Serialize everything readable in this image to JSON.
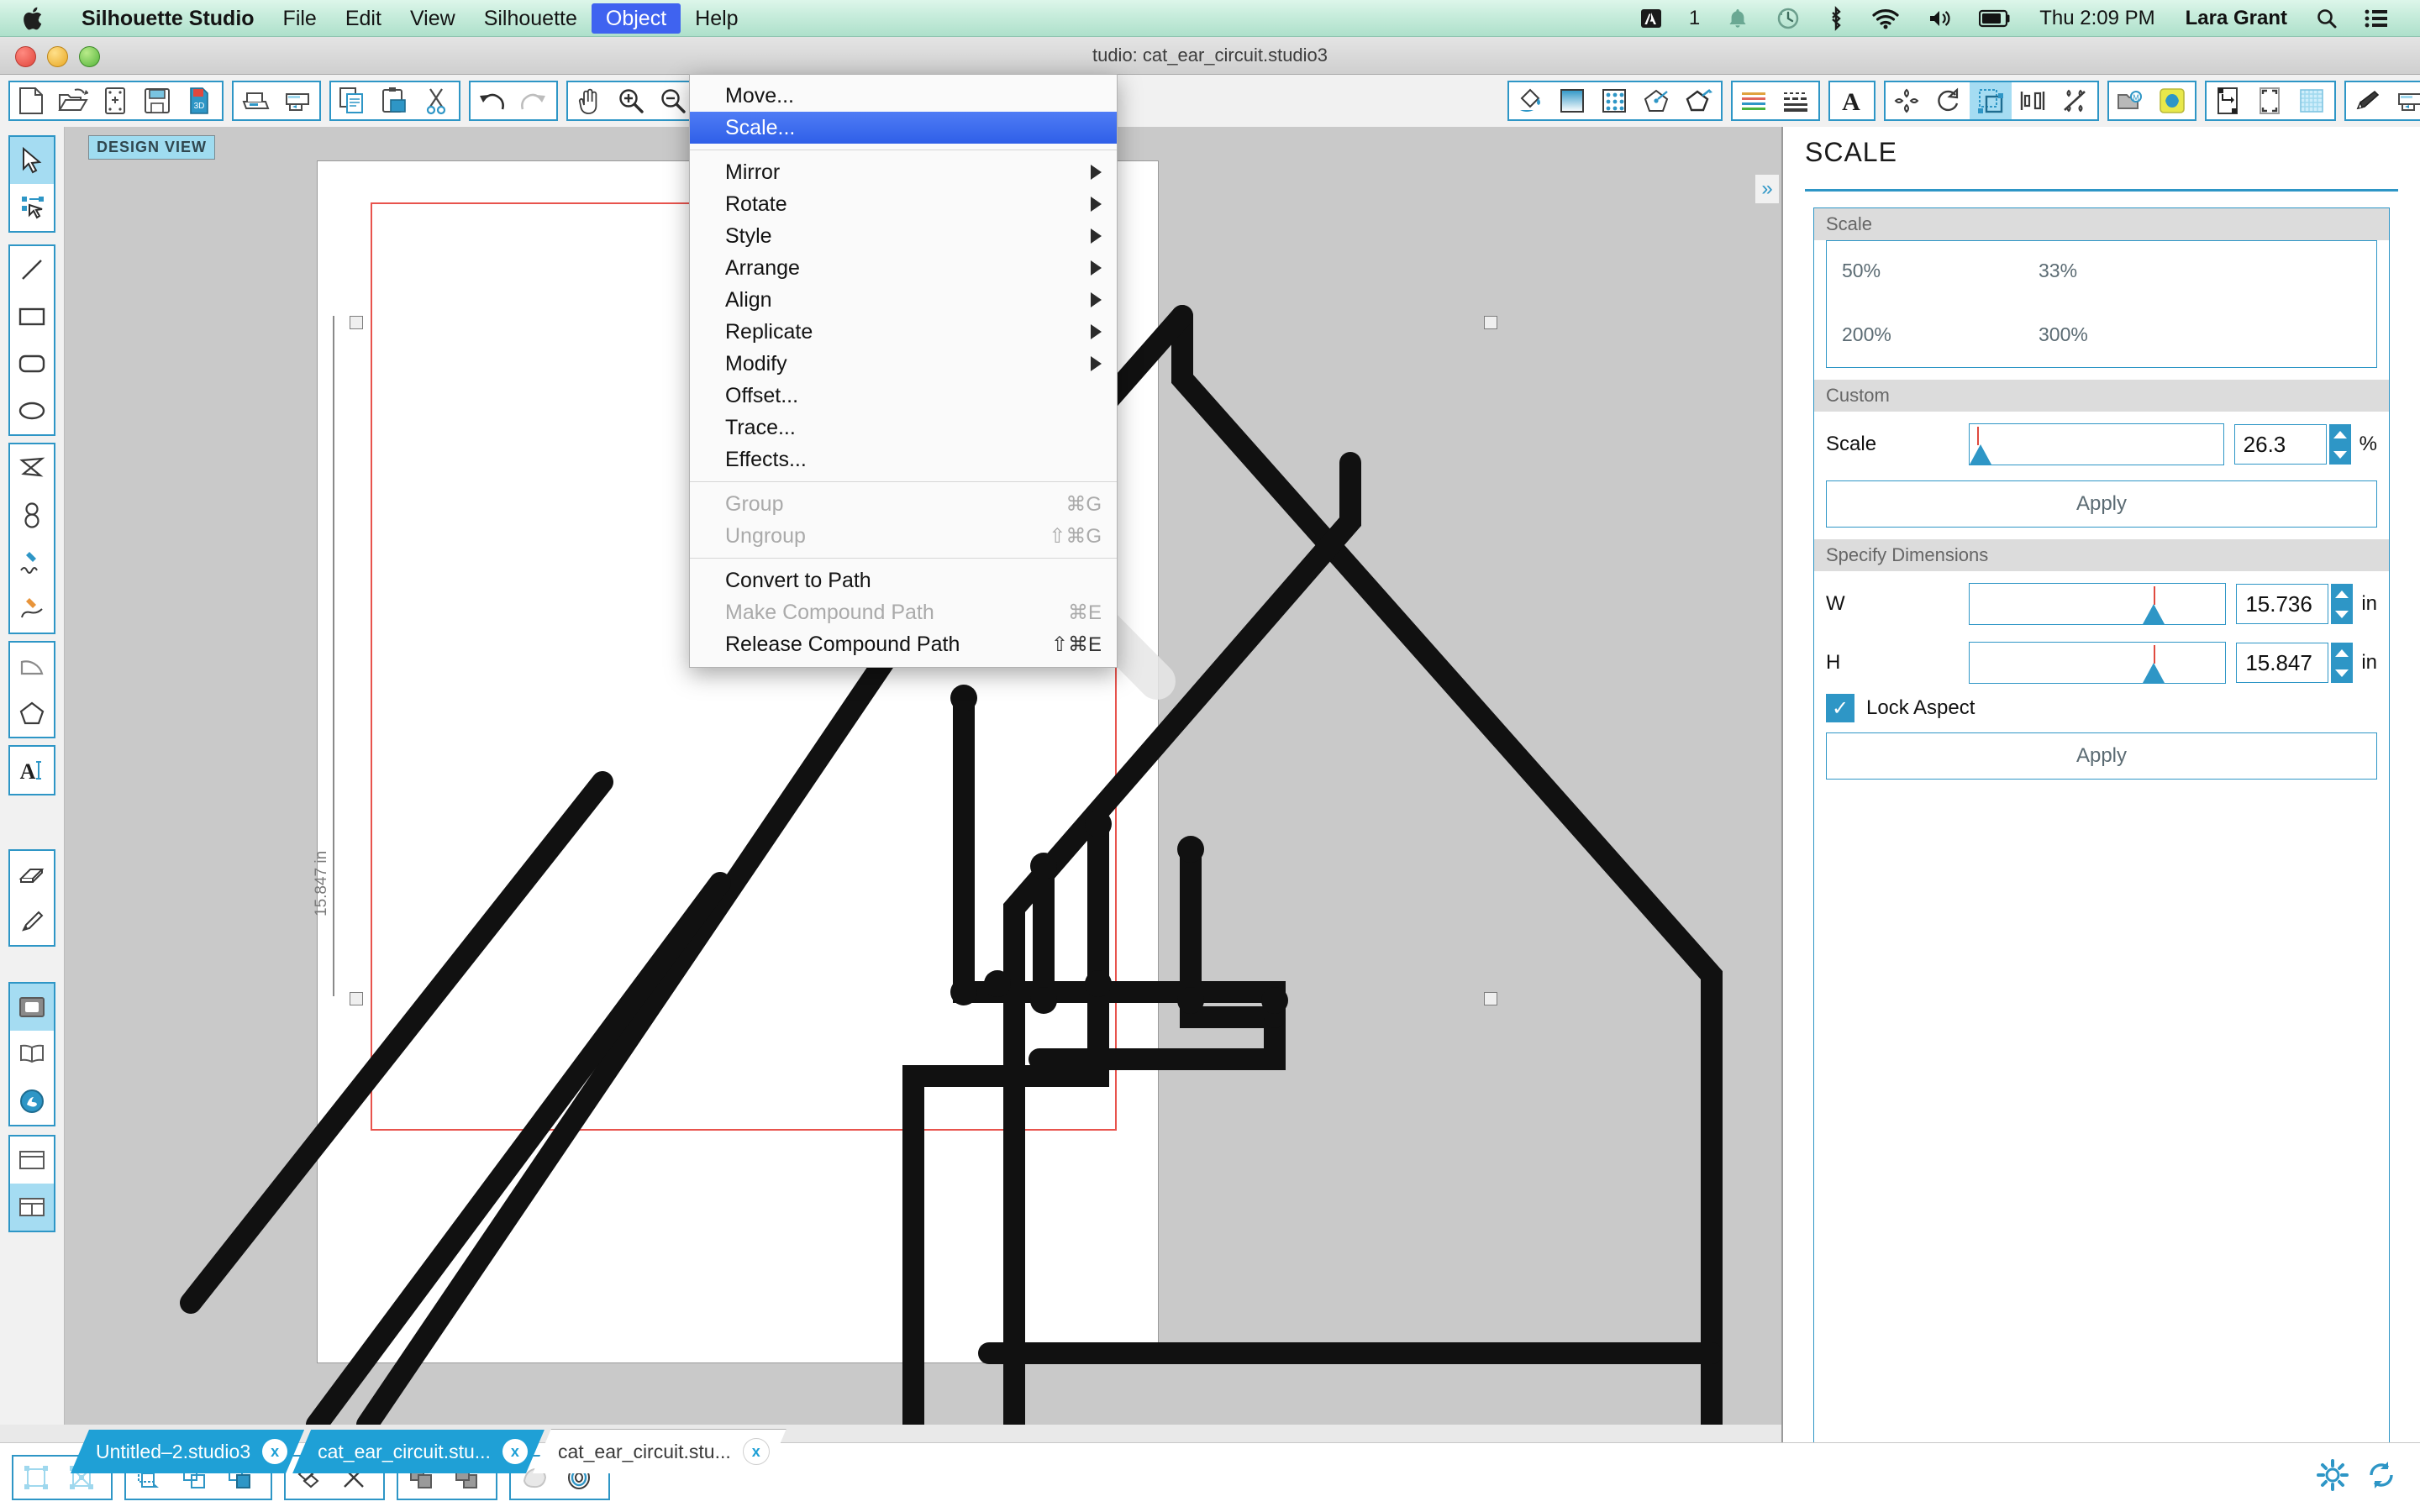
{
  "menubar": {
    "apple_icon": "apple-logo-icon",
    "app_name": "Silhouette Studio",
    "items": [
      {
        "label": "File",
        "active": false
      },
      {
        "label": "Edit",
        "active": false
      },
      {
        "label": "View",
        "active": false
      },
      {
        "label": "Silhouette",
        "active": false
      },
      {
        "label": "Object",
        "active": true
      },
      {
        "label": "Help",
        "active": false
      }
    ],
    "status_items": [
      {
        "name": "adobe-creative-cloud-icon",
        "label": ""
      },
      {
        "name": "notification-count",
        "label": "1"
      },
      {
        "name": "bell-icon",
        "label": ""
      },
      {
        "name": "time-machine-icon",
        "label": ""
      },
      {
        "name": "bluetooth-icon",
        "label": ""
      },
      {
        "name": "wifi-icon",
        "label": ""
      },
      {
        "name": "volume-icon",
        "label": ""
      },
      {
        "name": "battery-icon",
        "label": ""
      }
    ],
    "clock": "Thu 2:09 PM",
    "user_name": "Lara Grant",
    "search_icon": "spotlight-search-icon",
    "notification_center_icon": "notification-center-icon"
  },
  "window": {
    "title": "tudio: cat_ear_circuit.studio3"
  },
  "object_menu": {
    "groups": [
      {
        "items": [
          {
            "label": "Move...",
            "shortcut": "",
            "submenu": false,
            "disabled": false,
            "highlighted": false
          },
          {
            "label": "Scale...",
            "shortcut": "",
            "submenu": false,
            "disabled": false,
            "highlighted": true
          }
        ]
      },
      {
        "items": [
          {
            "label": "Mirror",
            "shortcut": "",
            "submenu": true,
            "disabled": false,
            "highlighted": false
          },
          {
            "label": "Rotate",
            "shortcut": "",
            "submenu": true,
            "disabled": false,
            "highlighted": false
          },
          {
            "label": "Style",
            "shortcut": "",
            "submenu": true,
            "disabled": false,
            "highlighted": false
          },
          {
            "label": "Arrange",
            "shortcut": "",
            "submenu": true,
            "disabled": false,
            "highlighted": false
          },
          {
            "label": "Align",
            "shortcut": "",
            "submenu": true,
            "disabled": false,
            "highlighted": false
          },
          {
            "label": "Replicate",
            "shortcut": "",
            "submenu": true,
            "disabled": false,
            "highlighted": false
          },
          {
            "label": "Modify",
            "shortcut": "",
            "submenu": true,
            "disabled": false,
            "highlighted": false
          },
          {
            "label": "Offset...",
            "shortcut": "",
            "submenu": false,
            "disabled": false,
            "highlighted": false
          },
          {
            "label": "Trace...",
            "shortcut": "",
            "submenu": false,
            "disabled": false,
            "highlighted": false
          },
          {
            "label": "Effects...",
            "shortcut": "",
            "submenu": false,
            "disabled": false,
            "highlighted": false
          }
        ]
      },
      {
        "items": [
          {
            "label": "Group",
            "shortcut": "⌘G",
            "submenu": false,
            "disabled": true,
            "highlighted": false
          },
          {
            "label": "Ungroup",
            "shortcut": "⇧⌘G",
            "submenu": false,
            "disabled": true,
            "highlighted": false
          }
        ]
      },
      {
        "items": [
          {
            "label": "Convert to Path",
            "shortcut": "",
            "submenu": false,
            "disabled": false,
            "highlighted": false
          },
          {
            "label": "Make Compound Path",
            "shortcut": "⌘E",
            "submenu": false,
            "disabled": true,
            "highlighted": false
          },
          {
            "label": "Release Compound Path",
            "shortcut": "⇧⌘E",
            "submenu": false,
            "disabled": false,
            "highlighted": false
          }
        ]
      }
    ]
  },
  "toolbar": {
    "groups": [
      {
        "buttons": [
          {
            "name": "new-document-icon"
          },
          {
            "name": "open-document-icon"
          },
          {
            "name": "new-page-icon"
          },
          {
            "name": "save-icon"
          },
          {
            "name": "save-as-sd-icon"
          }
        ]
      },
      {
        "buttons": [
          {
            "name": "print-icon"
          },
          {
            "name": "send-to-silhouette-icon"
          }
        ]
      },
      {
        "buttons": [
          {
            "name": "copy-icon"
          },
          {
            "name": "paste-icon"
          },
          {
            "name": "cut-icon"
          }
        ]
      },
      {
        "buttons": [
          {
            "name": "undo-icon"
          },
          {
            "name": "redo-icon"
          }
        ]
      },
      {
        "buttons": [
          {
            "name": "pan-hand-icon"
          },
          {
            "name": "zoom-in-icon"
          },
          {
            "name": "zoom-out-icon"
          }
        ]
      },
      {
        "buttons": [
          {
            "name": "fill-color-icon"
          },
          {
            "name": "fill-gradient-icon"
          },
          {
            "name": "fill-pattern-icon"
          },
          {
            "name": "line-color-icon"
          },
          {
            "name": "line-style-icon"
          }
        ]
      },
      {
        "buttons": [
          {
            "name": "line-weight-icon"
          },
          {
            "name": "dashed-line-icon"
          }
        ]
      },
      {
        "buttons": [
          {
            "name": "text-style-icon"
          }
        ]
      },
      {
        "buttons": [
          {
            "name": "move-object-icon"
          },
          {
            "name": "rotate-object-icon"
          },
          {
            "name": "scale-object-icon",
            "active": true
          },
          {
            "name": "align-object-icon"
          },
          {
            "name": "replicate-object-icon"
          }
        ]
      },
      {
        "buttons": [
          {
            "name": "library-icon"
          },
          {
            "name": "design-store-icon"
          }
        ]
      },
      {
        "buttons": [
          {
            "name": "page-setup-icon"
          },
          {
            "name": "registration-marks-icon"
          },
          {
            "name": "grid-icon"
          }
        ]
      },
      {
        "buttons": [
          {
            "name": "cut-settings-icon"
          },
          {
            "name": "send-to-cutter-icon"
          }
        ]
      }
    ]
  },
  "left_toolbar": {
    "groups": [
      {
        "buttons": [
          {
            "name": "select-arrow-tool",
            "active": true
          },
          {
            "name": "edit-points-tool",
            "active": false
          }
        ]
      },
      {
        "buttons": [
          {
            "name": "line-tool",
            "active": false
          },
          {
            "name": "rectangle-tool",
            "active": false
          },
          {
            "name": "rounded-rectangle-tool",
            "active": false
          },
          {
            "name": "ellipse-tool",
            "active": false
          }
        ]
      },
      {
        "buttons": [
          {
            "name": "polygon-tool",
            "active": false
          },
          {
            "name": "curve-tool",
            "active": false
          },
          {
            "name": "draw-freehand-tool",
            "active": false
          },
          {
            "name": "draw-smooth-tool",
            "active": false
          }
        ]
      },
      {
        "buttons": [
          {
            "name": "arc-tool",
            "active": false
          },
          {
            "name": "regular-polygon-tool",
            "active": false
          }
        ]
      },
      {
        "buttons": [
          {
            "name": "text-tool",
            "active": false
          }
        ]
      },
      {
        "buttons": [
          {
            "name": "eraser-tool",
            "active": false
          },
          {
            "name": "knife-tool",
            "active": false
          }
        ]
      },
      {
        "buttons": [
          {
            "name": "design-view-tool",
            "active": true
          },
          {
            "name": "library-view-tool",
            "active": false
          },
          {
            "name": "store-view-tool",
            "active": false
          }
        ]
      },
      {
        "buttons": [
          {
            "name": "single-pane-view-tool",
            "active": false
          },
          {
            "name": "split-pane-view-tool",
            "active": true
          }
        ]
      }
    ]
  },
  "canvas": {
    "view_badge": "DESIGN VIEW",
    "dimension_label": "15.847 in"
  },
  "tabs": [
    {
      "label": "Untitled–2.studio3",
      "close": "x",
      "selected": false
    },
    {
      "label": "cat_ear_circuit.stu...",
      "close": "x",
      "selected": false
    },
    {
      "label": "cat_ear_circuit.stu...",
      "close": "x",
      "selected": true
    }
  ],
  "scale_panel": {
    "title": "SCALE",
    "accent_color": "#2e96c6",
    "scale_section": {
      "header": "Scale",
      "presets": [
        "50%",
        "33%",
        "200%",
        "300%"
      ]
    },
    "custom_section": {
      "header": "Custom",
      "scale_label": "Scale",
      "scale_value": "26.3",
      "scale_unit": "%",
      "apply_label": "Apply"
    },
    "dimensions_section": {
      "header": "Specify Dimensions",
      "width_label": "W",
      "width_value": "15.736",
      "width_unit": "in",
      "height_label": "H",
      "height_value": "15.847",
      "height_unit": "in",
      "lock_aspect_label": "Lock Aspect",
      "lock_aspect_checked": true,
      "apply_label": "Apply"
    }
  },
  "status_bar": {
    "groups": [
      {
        "buttons": [
          {
            "name": "select-all-icon"
          },
          {
            "name": "select-points-icon"
          }
        ]
      },
      {
        "buttons": [
          {
            "name": "crop-icon"
          },
          {
            "name": "duplicate-icon"
          },
          {
            "name": "merge-icon"
          }
        ]
      },
      {
        "buttons": [
          {
            "name": "weld-icon"
          },
          {
            "name": "detach-icon"
          }
        ]
      },
      {
        "buttons": [
          {
            "name": "bring-forward-icon"
          },
          {
            "name": "send-backward-icon"
          }
        ]
      },
      {
        "buttons": [
          {
            "name": "shadow-icon"
          },
          {
            "name": "offset-ring-icon"
          }
        ]
      }
    ],
    "right_icons": [
      {
        "name": "preferences-gear-icon"
      },
      {
        "name": "refresh-icon"
      }
    ]
  }
}
